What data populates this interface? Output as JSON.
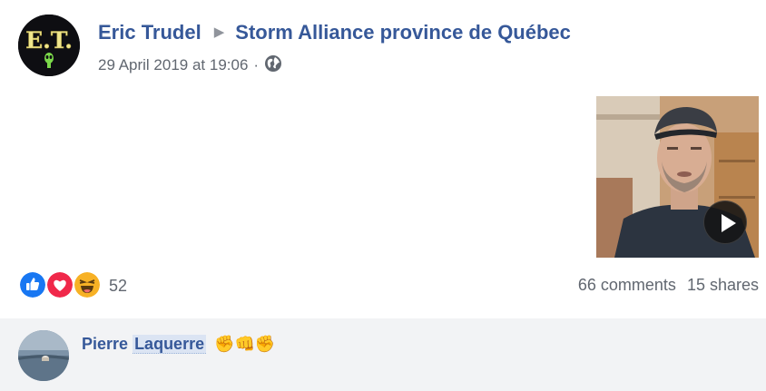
{
  "post": {
    "author": "Eric Trudel",
    "group": "Storm Alliance province de Québec",
    "timestamp": "29 April 2019 at 19:06",
    "separator": "·",
    "avatar_text": "E.T.",
    "privacy_icon": "globe-icon"
  },
  "media": {
    "type": "video",
    "icon": "play-icon"
  },
  "engagement": {
    "reactions": [
      "like-reaction-icon",
      "love-reaction-icon",
      "haha-reaction-icon"
    ],
    "reaction_count": "52",
    "comments": "66 comments",
    "shares": "15 shares"
  },
  "comment": {
    "author_first": "Pierre",
    "author_last": "Laquerre",
    "text": "✊👊✊"
  },
  "colors": {
    "link": "#365899",
    "meta": "#616770",
    "comment_bg": "#f2f3f5",
    "like": "#1877f2",
    "love": "#f0284a",
    "haha": "#f7b125"
  }
}
